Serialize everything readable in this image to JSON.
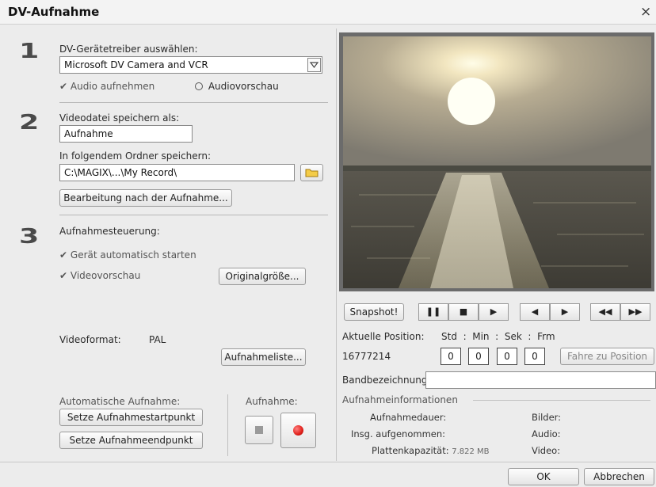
{
  "window": {
    "title": "DV-Aufnahme",
    "close_glyph": "×"
  },
  "step1": {
    "number": "1",
    "driver_label": "DV-Gerätetreiber auswählen:",
    "driver_value": "Microsoft DV Camera and VCR",
    "audio_record": "Audio aufnehmen",
    "audio_preview": "Audiovorschau"
  },
  "step2": {
    "number": "2",
    "file_label": "Videodatei speichern als:",
    "file_value": "Aufnahme",
    "folder_label": "In folgendem Ordner speichern:",
    "folder_value": "C:\\MAGIX\\...\\My Record\\",
    "edit_after_button": "Bearbeitung nach der Aufnahme..."
  },
  "step3": {
    "number": "3",
    "control_label": "Aufnahmesteuerung:",
    "autostart": "Gerät automatisch starten",
    "videopreview": "Videovorschau",
    "original_size_button": "Originalgröße...",
    "videoformat_label": "Videoformat:",
    "videoformat_value": "PAL",
    "recording_list_button": "Aufnahmeliste...",
    "auto_record_label": "Automatische Aufnahme:",
    "set_start_button": "Setze Aufnahmestartpunkt",
    "set_end_button": "Setze Aufnahmeendpunkt",
    "record_label": "Aufnahme:"
  },
  "transport": {
    "snapshot_button": "Snapshot!",
    "pause_glyph": "❚❚",
    "stop_glyph": "■",
    "play_glyph": "▶",
    "frame_back_glyph": "◀",
    "frame_fwd_glyph": "▶",
    "rewind_glyph": "◀◀",
    "ffwd_glyph": "▶▶"
  },
  "position": {
    "label": "Aktuelle Position:",
    "header": "Std  :  Min  :  Sek  :  Frm",
    "value": "16777214",
    "std": "0",
    "min": "0",
    "sek": "0",
    "frm": "0",
    "goto_button": "Fahre zu Position"
  },
  "tape": {
    "label": "Bandbezeichnung:",
    "value": ""
  },
  "info": {
    "section_title": "Aufnahmeinformationen",
    "duration_label": "Aufnahmedauer:",
    "total_label": "Insg. aufgenommen:",
    "disk_label": "Plattenkapazität:",
    "disk_value": "7.822 MB",
    "frames_label": "Bilder:",
    "audio_label": "Audio:",
    "video_label": "Video:"
  },
  "footer": {
    "ok_button": "OK",
    "cancel_button": "Abbrechen"
  },
  "colors": {
    "record_red": "#e0201a",
    "frame_gray": "#6b6b6b"
  }
}
